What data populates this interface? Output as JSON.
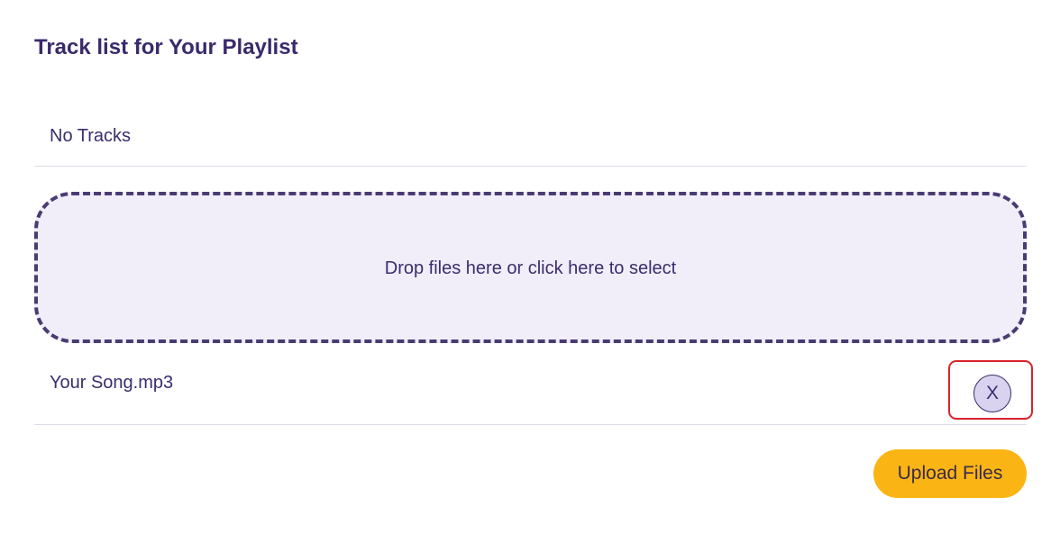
{
  "page": {
    "title": "Track list for Your Playlist"
  },
  "tracklist": {
    "empty_text": "No Tracks"
  },
  "dropzone": {
    "label": "Drop files here or click here to select"
  },
  "files": [
    {
      "name": "Your Song.mp3",
      "remove_label": "X"
    }
  ],
  "actions": {
    "upload_label": "Upload Files"
  },
  "colors": {
    "primary_text": "#3b2d6e",
    "dropzone_bg": "#f1eefa",
    "dropzone_border": "#4a3b73",
    "upload_button": "#fab515",
    "highlight": "#d9232b"
  }
}
